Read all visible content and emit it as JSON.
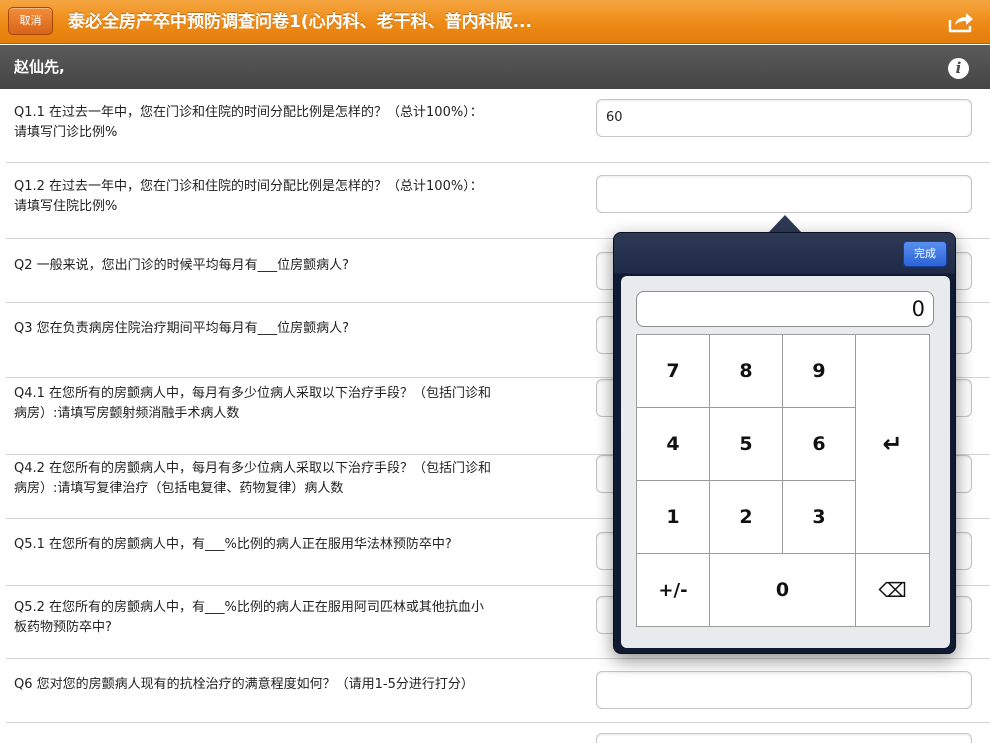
{
  "header": {
    "cancel_label": "取消",
    "title": "泰必全房产卒中预防调查问卷1(心内科、老干科、普内科版...",
    "share_icon": "share-icon"
  },
  "greeting": {
    "text": "赵仙先,",
    "info_icon": "info-icon"
  },
  "questions": [
    {
      "line1": "Q1.1 在过去一年中，您在门诊和住院的时间分配比例是怎样的？（总计100%）：",
      "line2": "请填写门诊比例%",
      "value": "60"
    },
    {
      "line1": "Q1.2 在过去一年中，您在门诊和住院的时间分配比例是怎样的？（总计100%）：",
      "line2": "请填写住院比例%",
      "value": ""
    },
    {
      "line1": "Q2 一般来说，您出门诊的时候平均每月有___位房颤病人?",
      "line2": "",
      "value": ""
    },
    {
      "line1": "Q3 您在负责病房住院治疗期间平均每月有___位房颤病人?",
      "line2": "",
      "value": ""
    },
    {
      "line1": "Q4.1 在您所有的房颤病人中，每月有多少位病人采取以下治疗手段？（包括门诊和",
      "line2": "病房）:请填写房颤射频消融手术病人数",
      "value": ""
    },
    {
      "line1": "Q4.2 在您所有的房颤病人中，每月有多少位病人采取以下治疗手段？（包括门诊和",
      "line2": "病房）:请填写复律治疗（包括电复律、药物复律）病人数",
      "value": ""
    },
    {
      "line1": "Q5.1 在您所有的房颤病人中，有___%比例的病人正在服用华法林预防卒中?",
      "line2": "",
      "value": ""
    },
    {
      "line1": "Q5.2 在您所有的房颤病人中，有___%比例的病人正在服用阿司匹林或其他抗血小",
      "line2": "板药物预防卒中?",
      "value": ""
    },
    {
      "line1": "Q6 您对您的房颤病人现有的抗栓治疗的满意程度如何？（请用1-5分进行打分）",
      "line2": "",
      "value": ""
    }
  ],
  "keypad": {
    "done_label": "完成",
    "display": "0",
    "keys": {
      "k7": "7",
      "k8": "8",
      "k9": "9",
      "k4": "4",
      "k5": "5",
      "k6": "6",
      "k1": "1",
      "k2": "2",
      "k3": "3",
      "sign": "+/-",
      "k0": "0",
      "enter": "↵",
      "backspace": "⌫"
    }
  }
}
